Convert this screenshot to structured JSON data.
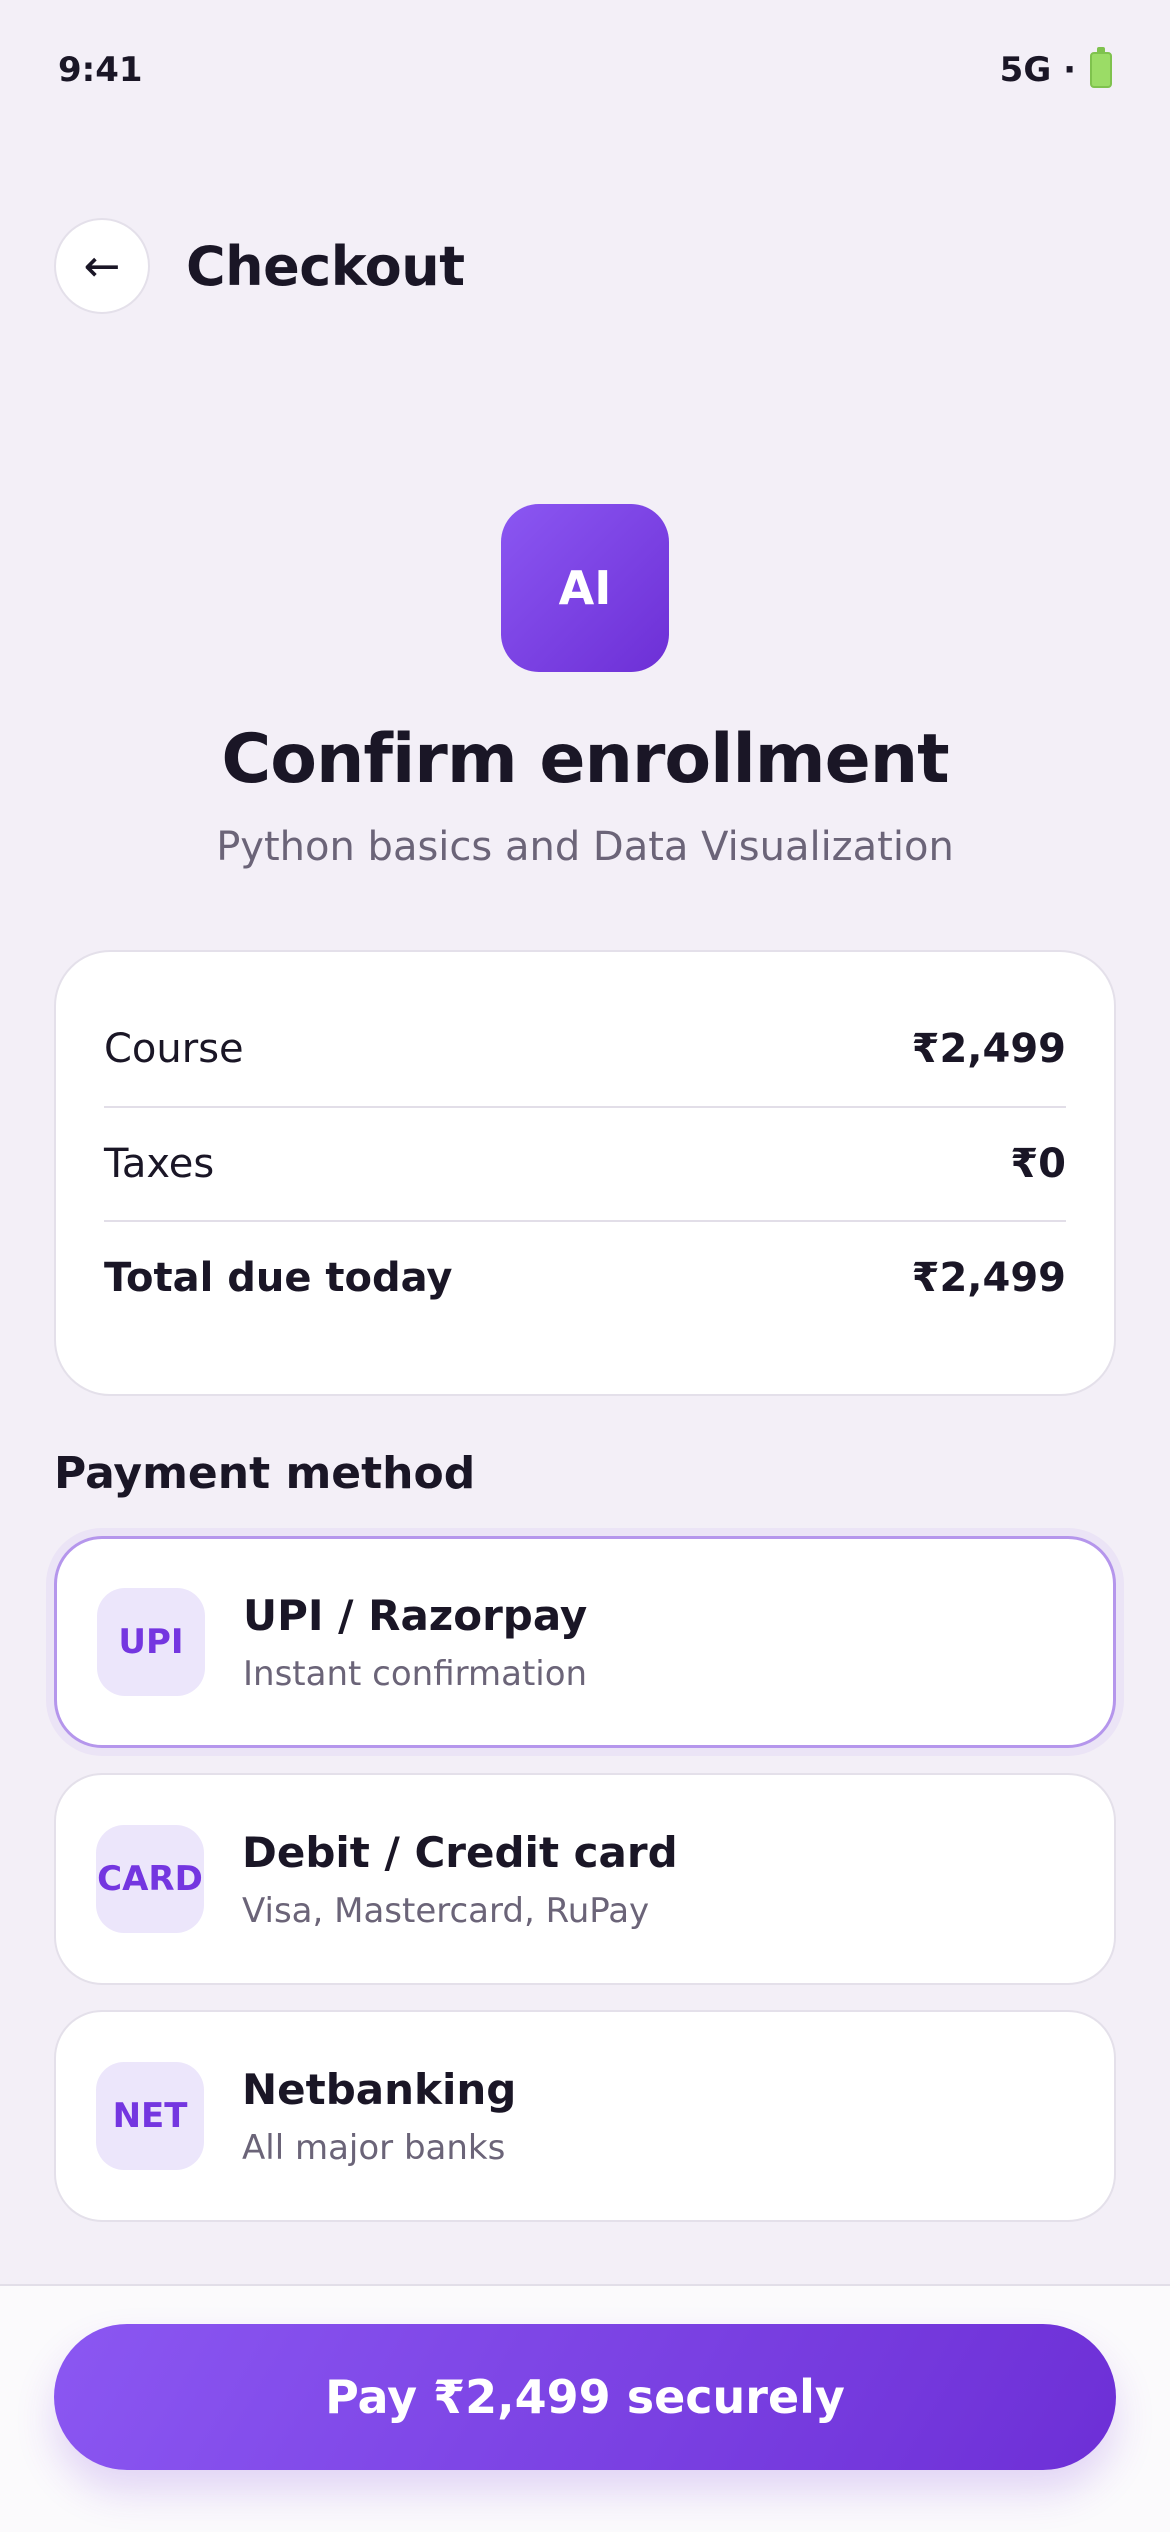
{
  "status_bar": {
    "time": "9:41",
    "network": "5G ·",
    "battery_color": "#9bdc66"
  },
  "header": {
    "back_icon": "←",
    "title": "Checkout"
  },
  "hero": {
    "logo_text": "AI",
    "title": "Confirm enrollment",
    "subtitle": "Python basics and Data Visualization"
  },
  "summary": {
    "rows": [
      {
        "label": "Course",
        "value": "₹2,499"
      },
      {
        "label": "Taxes",
        "value": "₹0"
      },
      {
        "label": "Total due today",
        "value": "₹2,499"
      }
    ]
  },
  "payment": {
    "section_title": "Payment method",
    "options": [
      {
        "badge": "UPI",
        "title": "UPI / Razorpay",
        "subtitle": "Instant confirmation",
        "selected": true
      },
      {
        "badge": "CARD",
        "title": "Debit / Credit card",
        "subtitle": "Visa, Mastercard, RuPay",
        "selected": false
      },
      {
        "badge": "NET",
        "title": "Netbanking",
        "subtitle": "All major banks",
        "selected": false
      }
    ]
  },
  "cta": {
    "label": "Pay ₹2,499 securely"
  },
  "colors": {
    "accent": "#7436e0",
    "accent_gradient_start": "#8b57f2",
    "accent_gradient_end": "#6d2fd6",
    "background": "#f3eff7"
  }
}
